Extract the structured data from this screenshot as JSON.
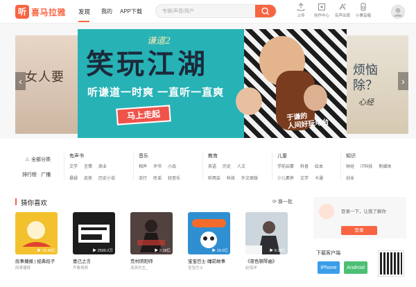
{
  "header": {
    "logo_mark": "听",
    "logo_text": "喜马拉雅",
    "nav": [
      "发现",
      "我的",
      "APP下载"
    ],
    "search_placeholder": "专辑/声音/用户",
    "tools": [
      "上传",
      "创作中心",
      "有声出版",
      "小雅音箱"
    ]
  },
  "carousel": {
    "left_text": "女人要",
    "right_text_1": "烦恼",
    "right_text_2": "除？",
    "right_small": "心经",
    "main_title": "笑玩江湖",
    "main_tag": "谦道2",
    "main_sub": "听谦道一时爽 一直听一直爽",
    "main_button": "马上走起",
    "main_caption_1": "于谦的",
    "main_caption_2": "人间好玩电台",
    "prev_arrow": "‹",
    "next_arrow": "›"
  },
  "categories": {
    "all_label": "全部分类",
    "rank_label": "排行榜",
    "radio_label": "广播",
    "groups": [
      {
        "head": "有声书",
        "row1": [
          "文学",
          "言情",
          "商业"
        ],
        "row2": [
          "悬疑",
          "武侠",
          "历史小说"
        ]
      },
      {
        "head": "音乐",
        "row1": [
          "相声",
          "评书",
          "小品"
        ],
        "row2": [
          "流行",
          "民谣",
          "轻音乐"
        ]
      },
      {
        "head": "教育",
        "row1": [
          "英语",
          "历史",
          "人文"
        ],
        "row2": [
          "听两会",
          "科技",
          "外文原版"
        ]
      },
      {
        "head": "儿童",
        "row1": [
          "学前启蒙",
          "科普",
          "绘本"
        ],
        "row2": [
          "少儿素养",
          "文学",
          "卡通"
        ]
      },
      {
        "head": "知识",
        "row1": [
          "财经",
          "IT科技",
          "新媒体"
        ],
        "row2": [
          "创业"
        ]
      }
    ]
  },
  "recommend": {
    "title": "猜你喜欢",
    "refresh": "换一批",
    "cards": [
      {
        "title": "段事播报 | 经典段子",
        "author": "段事播报",
        "plays": "10.48亿",
        "color": "#f3c12e"
      },
      {
        "title": "壹己之言",
        "author": "齐鲁视频",
        "plays": "2500.2万",
        "color": "#1d1d1d"
      },
      {
        "title": "荒村阴阳师",
        "author": "泡芙先生_",
        "plays": "3.18亿",
        "color": "#51413f"
      },
      {
        "title": "宝宝巴士·睡前故事",
        "author": "宝宝巴士",
        "plays": "16.0亿",
        "color": "#2f8fd1"
      },
      {
        "title": "《夜色钢琴曲》",
        "author": "赵海洋",
        "plays": "9.38亿",
        "color": "#ccd6dc"
      }
    ]
  },
  "login": {
    "prompt": "登录一下，让我了解你",
    "button": "登录"
  },
  "download": {
    "title": "下载客户端",
    "iphone": "iPhone",
    "android": "Android"
  },
  "colors": {
    "accent": "#f86442",
    "iphone": "#3a9ee8",
    "android": "#4bbf73"
  }
}
